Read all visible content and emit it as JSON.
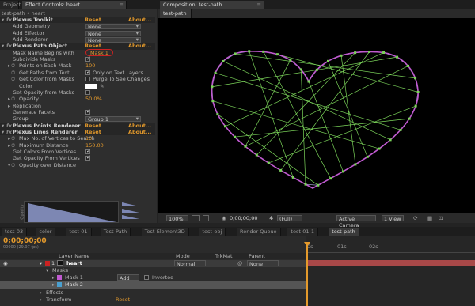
{
  "top_tabs": {
    "project": "Project",
    "effect_controls": "Effect Controls: heart",
    "composition": "Composition: test-path"
  },
  "breadcrumb": "test-path • heart",
  "comp_subtab": "test-path",
  "effects": [
    {
      "kind": "hdr",
      "label": "Plexus Toolkit",
      "reset": "Reset",
      "about": "About..."
    },
    {
      "kind": "sel",
      "label": "Add Geometry",
      "value": "None"
    },
    {
      "kind": "sel",
      "label": "Add Effector",
      "value": "None"
    },
    {
      "kind": "sel",
      "label": "Add Renderer",
      "value": "None"
    },
    {
      "kind": "hdr",
      "label": "Plexus Path Object",
      "reset": "Reset",
      "about": "About..."
    },
    {
      "kind": "mask",
      "label": "Mask Name Begins with",
      "value": "Mask 1"
    },
    {
      "kind": "chk",
      "label": "Subdivide Masks",
      "checked": true
    },
    {
      "kind": "num",
      "label": "Points on Each Mask",
      "value": "100"
    },
    {
      "kind": "chk2",
      "label": "Get Paths from Text",
      "checked": false,
      "extra": "Only on Text Layers",
      "extra_checked": true
    },
    {
      "kind": "chk2",
      "label": "Get Color from Masks",
      "checked": false,
      "extra": "Purge To See Changes",
      "extra_checked": false
    },
    {
      "kind": "color",
      "label": "Color"
    },
    {
      "kind": "chk",
      "label": "Get Opacity from Masks",
      "checked": false
    },
    {
      "kind": "num",
      "label": "Opacity",
      "value": "50.0%"
    },
    {
      "kind": "plain",
      "label": "Replication"
    },
    {
      "kind": "chk",
      "label": "Generate Facets",
      "checked": true
    },
    {
      "kind": "sel",
      "label": "Group",
      "value": "Group 1"
    },
    {
      "kind": "hdr",
      "label": "Plexus Points Renderer",
      "reset": "Reset",
      "about": "About..."
    },
    {
      "kind": "hdr",
      "label": "Plexus Lines Renderer",
      "reset": "Reset",
      "about": "About..."
    },
    {
      "kind": "num",
      "label": "Max No. of Vertices to Search",
      "value": "10"
    },
    {
      "kind": "num",
      "label": "Maximum Distance",
      "value": "150.00"
    },
    {
      "kind": "chk",
      "label": "Get Colors From Vertices",
      "checked": true
    },
    {
      "kind": "chk",
      "label": "Get Opacity From Vertices",
      "checked": true
    },
    {
      "kind": "plain",
      "label": "Opacity over Distance"
    }
  ],
  "graph_axis": "Opacity",
  "comp_bar": {
    "zoom": "100%",
    "timecode": "0;00;00;00",
    "resolution": "(Full)",
    "camera": "Active Camera",
    "view": "1 View"
  },
  "timeline_tabs": [
    "test-03",
    "color",
    "test-01",
    "Test-Path",
    "Test-Element3D",
    "test-obj",
    "Render Queue",
    "test-01-1",
    "test-path"
  ],
  "timeline": {
    "timecode": "0;00;00;00",
    "fps": "00000 (29.97 fps)",
    "layer_name_hdr": "Layer Name",
    "mode_hdr": "Mode",
    "trkmat_hdr": "TrkMat",
    "parent_hdr": "Parent",
    "layer_num": "1",
    "layer_name": "heart",
    "layer_mode": "Normal",
    "layer_parent": "None",
    "masks": "Masks",
    "mask1": "Mask 1",
    "mask2": "Mask 2",
    "mask_mode": "Add",
    "inverted": "Inverted",
    "effects": "Effects",
    "transform": "Transform",
    "reset": "Reset",
    "ruler": [
      "0s",
      "01s",
      "02s"
    ]
  },
  "colors": {
    "accent": "#e49a2c",
    "plexus_line": "#7bd45a",
    "mask_outline": "#c05ad0",
    "mask_red": "#cc2222"
  }
}
